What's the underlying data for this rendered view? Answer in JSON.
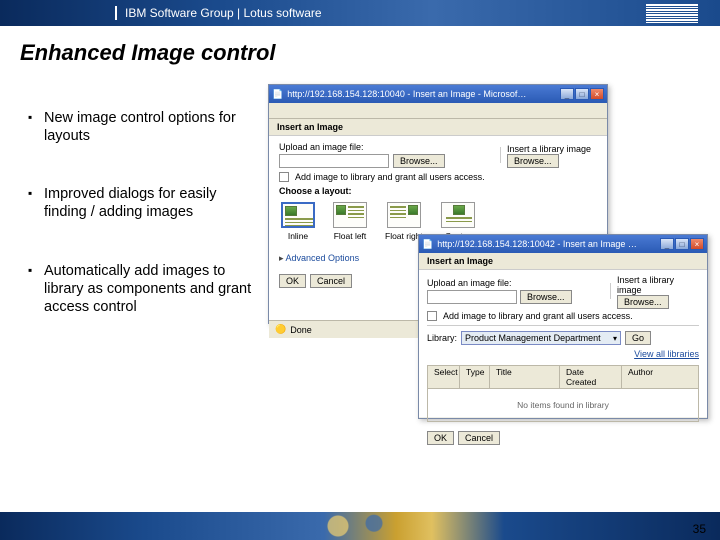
{
  "header": {
    "group_label": "IBM Software Group | Lotus software"
  },
  "slide": {
    "title": "Enhanced Image control",
    "bullets": [
      "New image control options for layouts",
      "Improved dialogs for easily finding / adding images",
      "Automatically add images to library as components and grant access control"
    ]
  },
  "dialog1": {
    "title": "http://192.168.154.128:10040 - Insert an Image - Microsoft Internet Explorer",
    "section_header": "Insert an Image",
    "upload_label": "Upload an image file:",
    "insert_library_label": "Insert a library image",
    "browse_btn": "Browse...",
    "add_library_checkbox": "Add image to library and grant all users access.",
    "choose_layout_label": "Choose a layout:",
    "layouts": [
      {
        "label": "Inline"
      },
      {
        "label": "Float left"
      },
      {
        "label": "Float right"
      },
      {
        "label": "Center"
      }
    ],
    "advanced_label": "Advanced Options",
    "ok": "OK",
    "cancel": "Cancel",
    "status": "Done"
  },
  "dialog2": {
    "title": "http://192.168.154.128:10042 - Insert an Image - Microsoft Internet Explorer",
    "section_header": "Insert an Image",
    "upload_label": "Upload an image file:",
    "insert_library_label": "Insert a library image",
    "browse_btn": "Browse...",
    "add_library_checkbox": "Add image to library and grant all users access.",
    "library_label": "Library:",
    "library_selected": "Product Management Department",
    "go": "Go",
    "view_all": "View all libraries",
    "columns": [
      "Select",
      "Type",
      "Title",
      "Date Created",
      "Author"
    ],
    "empty_msg": "No items found in library",
    "ok": "OK",
    "cancel": "Cancel"
  },
  "page_number": "35"
}
